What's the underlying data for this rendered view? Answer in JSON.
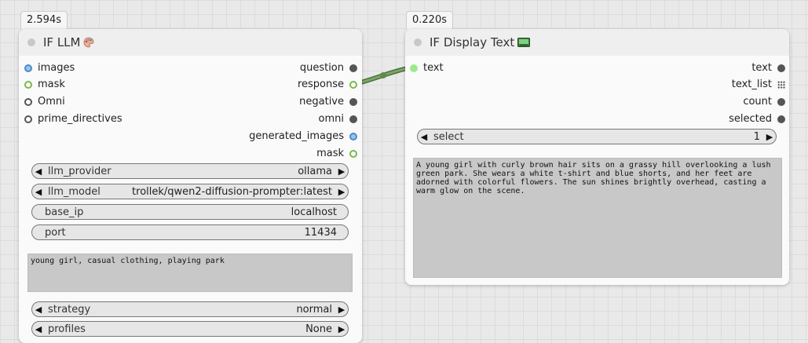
{
  "llm_node": {
    "timing": "2.594s",
    "title": "IF LLM",
    "title_icon": "palette-icon",
    "inputs": [
      {
        "label": "images",
        "color": "#4a8cc9"
      },
      {
        "label": "mask",
        "color": "#7ab84b"
      },
      {
        "label": "Omni",
        "color": "#555555"
      },
      {
        "label": "prime_directives",
        "color": "#555555"
      }
    ],
    "outputs": [
      {
        "label": "question"
      },
      {
        "label": "response"
      },
      {
        "label": "negative"
      },
      {
        "label": "omni"
      },
      {
        "label": "generated_images"
      },
      {
        "label": "mask"
      }
    ],
    "widgets": {
      "llm_provider": {
        "label": "llm_provider",
        "value": "ollama"
      },
      "llm_model": {
        "label": "llm_model",
        "value": "trollek/qwen2-diffusion-prompter:latest"
      },
      "base_ip": {
        "label": "base_ip",
        "value": "localhost"
      },
      "port": {
        "label": "port",
        "value": "11434"
      },
      "strategy": {
        "label": "strategy",
        "value": "normal"
      },
      "profiles": {
        "label": "profiles",
        "value": "None"
      }
    },
    "prompt_text": "young girl, casual clothing, playing park"
  },
  "display_node": {
    "timing": "0.220s",
    "title": "IF Display Text",
    "title_icon": "monitor-icon",
    "input": {
      "label": "text"
    },
    "outputs": [
      {
        "label": "text"
      },
      {
        "label": "text_list"
      },
      {
        "label": "count"
      },
      {
        "label": "selected"
      }
    ],
    "select": {
      "label": "select",
      "value": "1"
    },
    "display_text": "A young girl with curly brown hair sits on a grassy hill overlooking a lush green park. She wears a white t-shirt and blue shorts, and her feet are adorned with colorful flowers. The sun shines brightly overhead, casting a warm glow on the scene."
  },
  "colors": {
    "link": "#6a9a55",
    "canvas": "#e9e9e9",
    "text_area": "#c8c8c8"
  }
}
